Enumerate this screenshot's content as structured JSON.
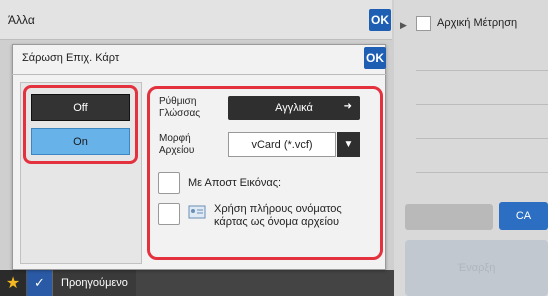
{
  "background": {
    "title": "Άλλα",
    "ok_label": "OK",
    "right_panel": {
      "checkbox_label": "Αρχική Μέτρηση",
      "disabled_button_label": "",
      "ca_label": "CA",
      "start_label": "Έναρξη"
    },
    "bottom_bar": {
      "previous_label": "Προηγούμενο"
    }
  },
  "dialog": {
    "title": "Σάρωση Επιχ. Κάρτ",
    "ok_label": "OK",
    "off_label": "Off",
    "on_label": "On",
    "selected_toggle": "On",
    "language_label_line1": "Ρύθμιση",
    "language_label_line2": "Γλώσσας",
    "language_value": "Αγγλικά",
    "format_label_line1": "Μορφή",
    "format_label_line2": "Αρχείου",
    "format_value": "vCard (*.vcf)",
    "send_image_label": "Με Αποστ Εικόνας:",
    "full_name_label_line1": "Χρήση πλήρους ονόματος",
    "full_name_label_line2": "κάρτας ως όνομα αρχείου"
  },
  "colors": {
    "accent_blue": "#1e5fb4",
    "highlight_red": "#e3313e",
    "selected_on": "#67b2e8",
    "dark_button": "#2f2f2f"
  }
}
